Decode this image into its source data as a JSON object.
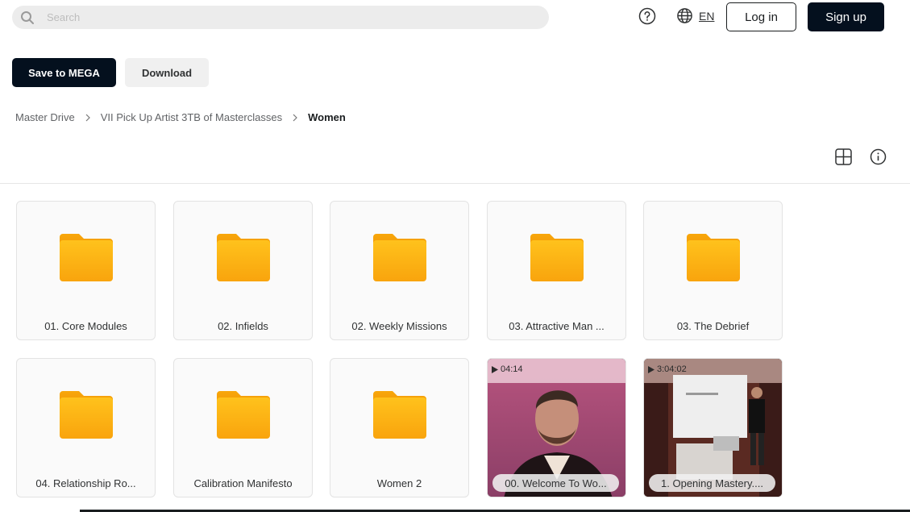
{
  "header": {
    "search_placeholder": "Search",
    "language": "EN",
    "login_label": "Log in",
    "signup_label": "Sign up"
  },
  "actions": {
    "save_label": "Save to MEGA",
    "download_label": "Download"
  },
  "breadcrumb": {
    "items": [
      "Master Drive",
      "VII Pick Up Artist 3TB of Masterclasses"
    ],
    "current": "Women"
  },
  "items": [
    {
      "type": "folder",
      "name": "01. Core Modules"
    },
    {
      "type": "folder",
      "name": "02. Infields"
    },
    {
      "type": "folder",
      "name": "02. Weekly Missions"
    },
    {
      "type": "folder",
      "name": "03. Attractive Man ..."
    },
    {
      "type": "folder",
      "name": "03. The Debrief"
    },
    {
      "type": "folder",
      "name": "04. Relationship Ro..."
    },
    {
      "type": "folder",
      "name": "Calibration Manifesto"
    },
    {
      "type": "folder",
      "name": "Women 2"
    },
    {
      "type": "video",
      "name": "00. Welcome To Wo...",
      "duration": "04:14"
    },
    {
      "type": "video",
      "name": "1. Opening Mastery....",
      "duration": "3:04:02"
    }
  ],
  "colors": {
    "primary_dark": "#04101e",
    "folder_top": "#ffc21c",
    "folder_bottom": "#f9a40d",
    "surface": "#fafafa"
  },
  "icons": [
    "search-icon",
    "help-icon",
    "globe-icon",
    "chevron-right-icon",
    "grid-view-icon",
    "info-icon",
    "folder-icon",
    "play-icon"
  ]
}
